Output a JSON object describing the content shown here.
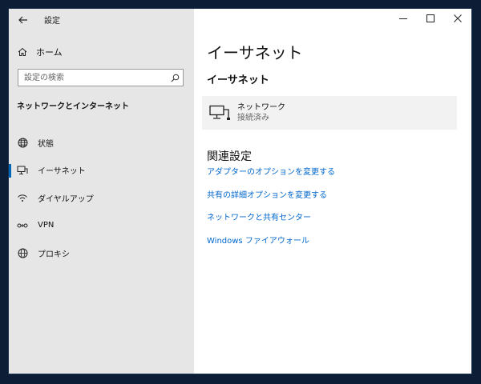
{
  "window": {
    "title": "設定",
    "controls": {
      "minimize": "—",
      "maximize": "☐",
      "close": "✕"
    }
  },
  "sidebar": {
    "home_label": "ホーム",
    "search_placeholder": "設定の検索",
    "section_title": "ネットワークとインターネット",
    "items": [
      {
        "label": "状態",
        "icon": "status-globe-icon",
        "selected": false
      },
      {
        "label": "イーサネット",
        "icon": "ethernet-icon",
        "selected": true
      },
      {
        "label": "ダイヤルアップ",
        "icon": "dialup-icon",
        "selected": false
      },
      {
        "label": "VPN",
        "icon": "vpn-icon",
        "selected": false
      },
      {
        "label": "プロキシ",
        "icon": "proxy-globe-icon",
        "selected": false
      }
    ]
  },
  "main": {
    "page_title": "イーサネット",
    "subtitle": "イーサネット",
    "network": {
      "name": "ネットワーク",
      "status": "接続済み",
      "icon": "network-monitor-icon"
    },
    "related_title": "関連設定",
    "links": [
      "アダプターのオプションを変更する",
      "共有の詳細オプションを変更する",
      "ネットワークと共有センター",
      "Windows ファイアウォール"
    ]
  },
  "colors": {
    "accent": "#0067b8",
    "link": "#0066cc",
    "sidebar_bg": "#e6e6e6",
    "card_bg": "#f2f2f2",
    "desktop_bg": "#0c1d35"
  }
}
